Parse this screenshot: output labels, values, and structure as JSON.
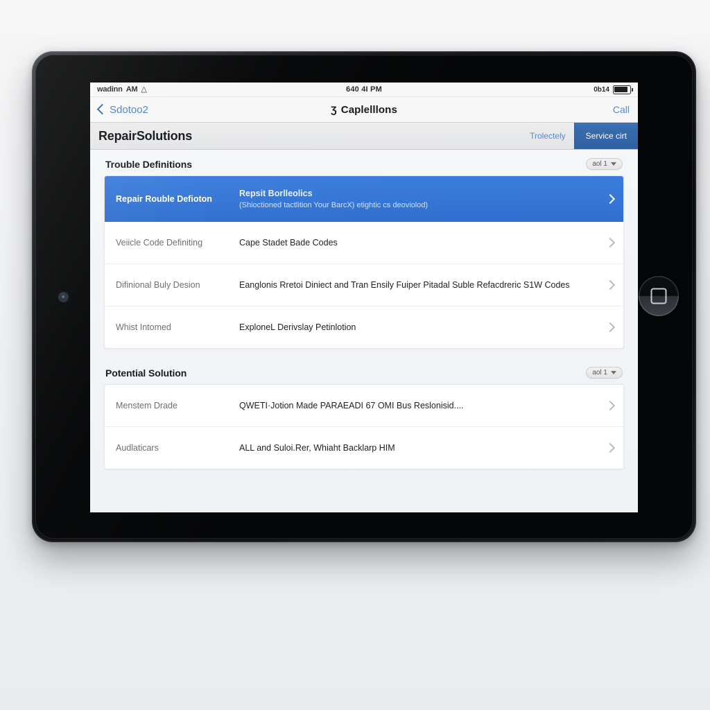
{
  "device": {
    "type": "tablet-landscape",
    "home_button_icon": "home-square-icon",
    "camera_icon": "front-camera-icon"
  },
  "status_bar": {
    "carrier": "wadinn",
    "meridiem": "AM",
    "wifi_icon": "wifi-icon",
    "time": "640 4I PM",
    "battery_percent": "0b14",
    "battery_icon": "battery-icon"
  },
  "nav_bar": {
    "back_icon": "chevron-left-icon",
    "back_label": "Sdotoo2",
    "title_icon": "lightning-bolt-icon",
    "title_icon_glyph": "Ʒ",
    "title": "Caplelllons",
    "right_action": "Call"
  },
  "app_toolbar": {
    "title": "RepairSolutions",
    "link_label": "Trolectely",
    "primary_label": "Service cirt"
  },
  "sections": [
    {
      "title": "Trouble Definitions",
      "pill_label": "aol 1",
      "pill_icon": "chevron-down-icon",
      "rows": [
        {
          "label": "Repair Rouble Defioton",
          "main": "Repsit Borlleolics",
          "sub": "(Shioctioned tactlition Your BarcX) etightic cs deoviolod)",
          "selected": true,
          "chevron_icon": "chevron-right-icon"
        },
        {
          "label": "Veiicle Code Definiting",
          "main": "Cape Stadet Bade Codes",
          "sub": "",
          "selected": false,
          "chevron_icon": "chevron-right-icon"
        },
        {
          "label": "Difinional Buly Desion",
          "main": "Eanglonis Rretoi Diniect and Tran Ensily Fuiper Pitadal Suble Refacdreric S1W Codes",
          "sub": "",
          "selected": false,
          "chevron_icon": "chevron-right-icon"
        },
        {
          "label": "Whist Intomed",
          "main": "ExploneL Derivslay Petinlotion",
          "sub": "",
          "selected": false,
          "chevron_icon": "chevron-right-icon"
        }
      ]
    },
    {
      "title": "Potential Solution",
      "pill_label": "aol 1",
      "pill_icon": "chevron-down-icon",
      "rows": [
        {
          "label": "Menstem Drade",
          "main": "QWETI·Jotion Made PARAEADI 67 OMI Bus Reslonisid....",
          "sub": "",
          "selected": false,
          "chevron_icon": "chevron-right-icon"
        },
        {
          "label": "Audlaticars",
          "main": "ALL and Suloi.Rer, Whiaht Backlarp HIM",
          "sub": "",
          "selected": false,
          "chevron_icon": "chevron-right-icon"
        }
      ]
    }
  ],
  "colors": {
    "accent_blue": "#2f6fd0",
    "link_blue": "#5d87c4",
    "toolbar_primary": "#32619f",
    "screen_bg": "#f1f4f7",
    "card_bg": "#ffffff"
  }
}
